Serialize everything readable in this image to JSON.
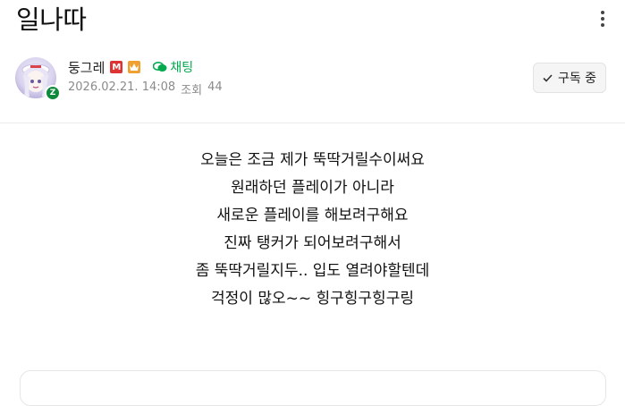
{
  "post": {
    "title": "일나따",
    "author": {
      "name": "둥그레",
      "badge_m": "M",
      "chat_label": "채팅",
      "avatar_badge": "Z"
    },
    "meta": {
      "date": "2026.02.21. 14:08",
      "views_label": "조회",
      "views": "44"
    },
    "subscribe_label": "구독 중",
    "body_lines": [
      "오늘은 조금 제가 뚝딱거릴수이써요",
      "원래하던 플레이가 아니라",
      "새로운 플레이를 해보려구해요",
      "진짜 탱커가 되어보려구해서",
      "좀 뚝딱거릴지두.. 입도 열려야할텐데",
      "걱정이 많오~~ 힝구힝구힝구링"
    ]
  },
  "colors": {
    "chat_green": "#03a94e",
    "meta_gray": "#8b8b8b",
    "badge_m": "#dd3333",
    "badge_crown": "#f0a030"
  },
  "icons": [
    "more-vertical-icon",
    "manager-badge-icon",
    "crown-icon",
    "chat-icon",
    "check-icon"
  ]
}
